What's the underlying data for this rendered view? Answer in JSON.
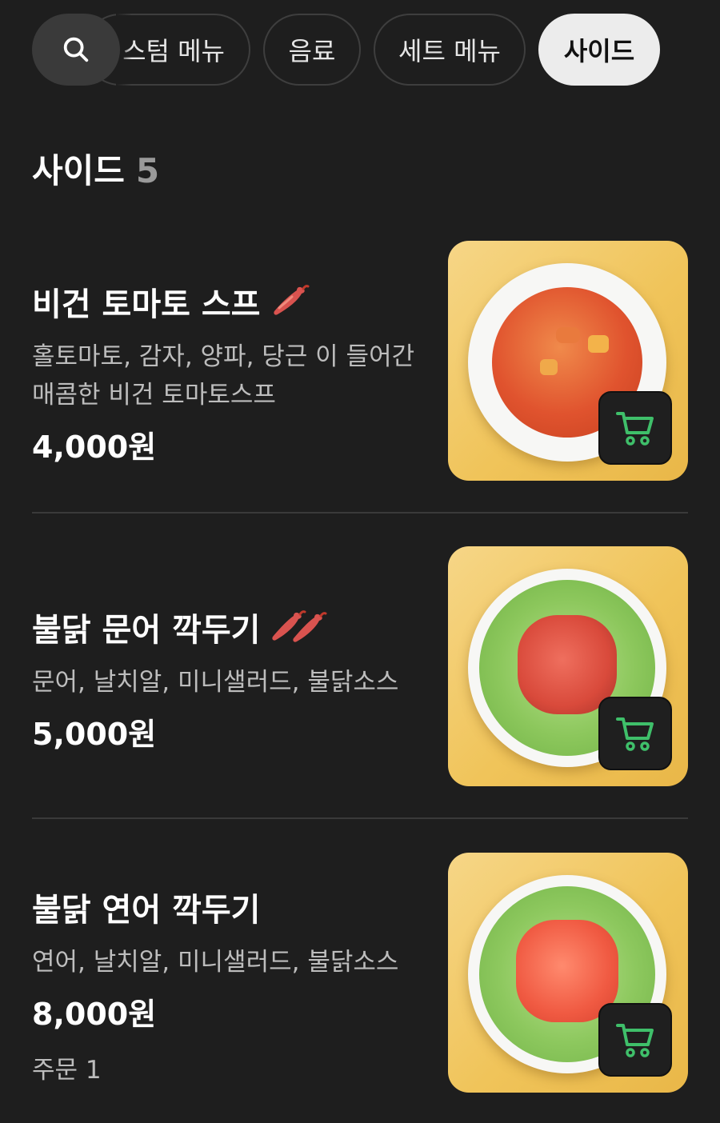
{
  "tabs": {
    "search_icon": "search-icon",
    "items": [
      {
        "label": "스텀 메뉴"
      },
      {
        "label": "음료"
      },
      {
        "label": "세트 메뉴"
      },
      {
        "label": "사이드"
      }
    ],
    "selected": "사이드"
  },
  "section": {
    "title": "사이드",
    "count": "5"
  },
  "menu_items": [
    {
      "name": "비건 토마토 스프",
      "spice_level": 1,
      "description_lines": [
        "홀토마토, 감자, 양파, 당근 이 들어간",
        "매콤한 비건 토마토스프"
      ],
      "price": "4,000원"
    },
    {
      "name": "불닭 문어 깍두기",
      "spice_level": 2,
      "description_lines": [
        "문어, 날치알, 미니샐러드, 불닭소스"
      ],
      "price": "5,000원"
    },
    {
      "name": "불닭 연어 깍두기",
      "spice_level": 0,
      "description_lines": [
        "연어, 날치알, 미니샐러드, 불닭소스"
      ],
      "price": "8,000원",
      "order_status": "주문 1"
    }
  ],
  "colors": {
    "background": "#1e1e1e",
    "chip_selected_bg": "#ececec",
    "cart_icon": "#3fbf6a",
    "chili": "#d9534f"
  },
  "icons": {
    "cart": "cart-icon",
    "chili": "chili-pepper-icon"
  }
}
